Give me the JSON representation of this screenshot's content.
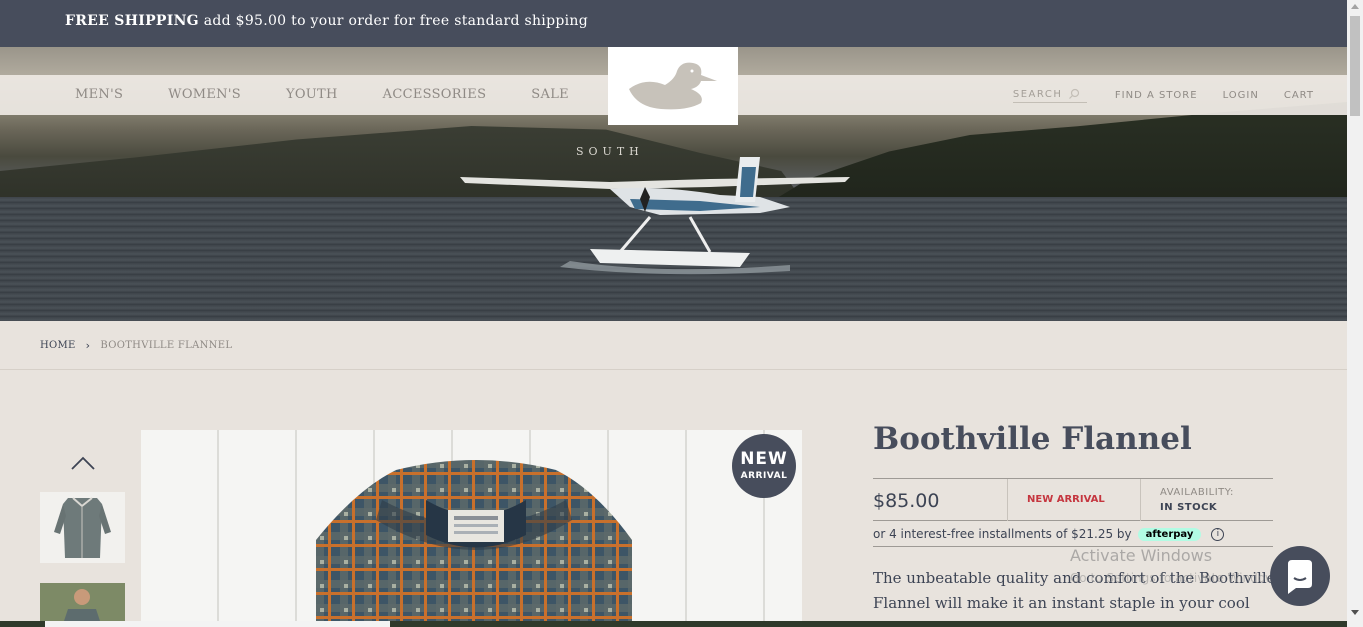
{
  "announcement": {
    "bold": "FREE SHIPPING",
    "text": " add $95.00 to your order for free standard shipping"
  },
  "nav": {
    "items": [
      "MEN'S",
      "WOMEN'S",
      "YOUTH",
      "ACCESSORIES",
      "SALE"
    ],
    "search_placeholder": "SEARCH",
    "find_store": "FIND A STORE",
    "login": "LOGIN",
    "cart": "CART"
  },
  "hero": {
    "overlay_text": "SOUTH"
  },
  "breadcrumb": {
    "home": "HOME",
    "current": "BOOTHVILLE FLANNEL"
  },
  "product": {
    "badge_line1": "NEW",
    "badge_line2": "ARRIVAL",
    "title": "Boothville Flannel",
    "price": "$85.00",
    "tag": "NEW ARRIVAL",
    "availability_label": "AVAILABILITY:",
    "availability_value": "IN STOCK",
    "installments": "or 4 interest-free installments of $21.25 by",
    "afterpay": "afterpay",
    "description": "The unbeatable quality and comfort of the Boothville Flannel will make it an instant staple in your cool"
  },
  "os_watermark": {
    "line1": "Activate Windows",
    "line2": "Go to Settings to activate Windows."
  },
  "colors": {
    "dark": "#474d5c",
    "background": "#e8e3dd",
    "accent_red": "#c5363f",
    "afterpay": "#b2fce4"
  }
}
